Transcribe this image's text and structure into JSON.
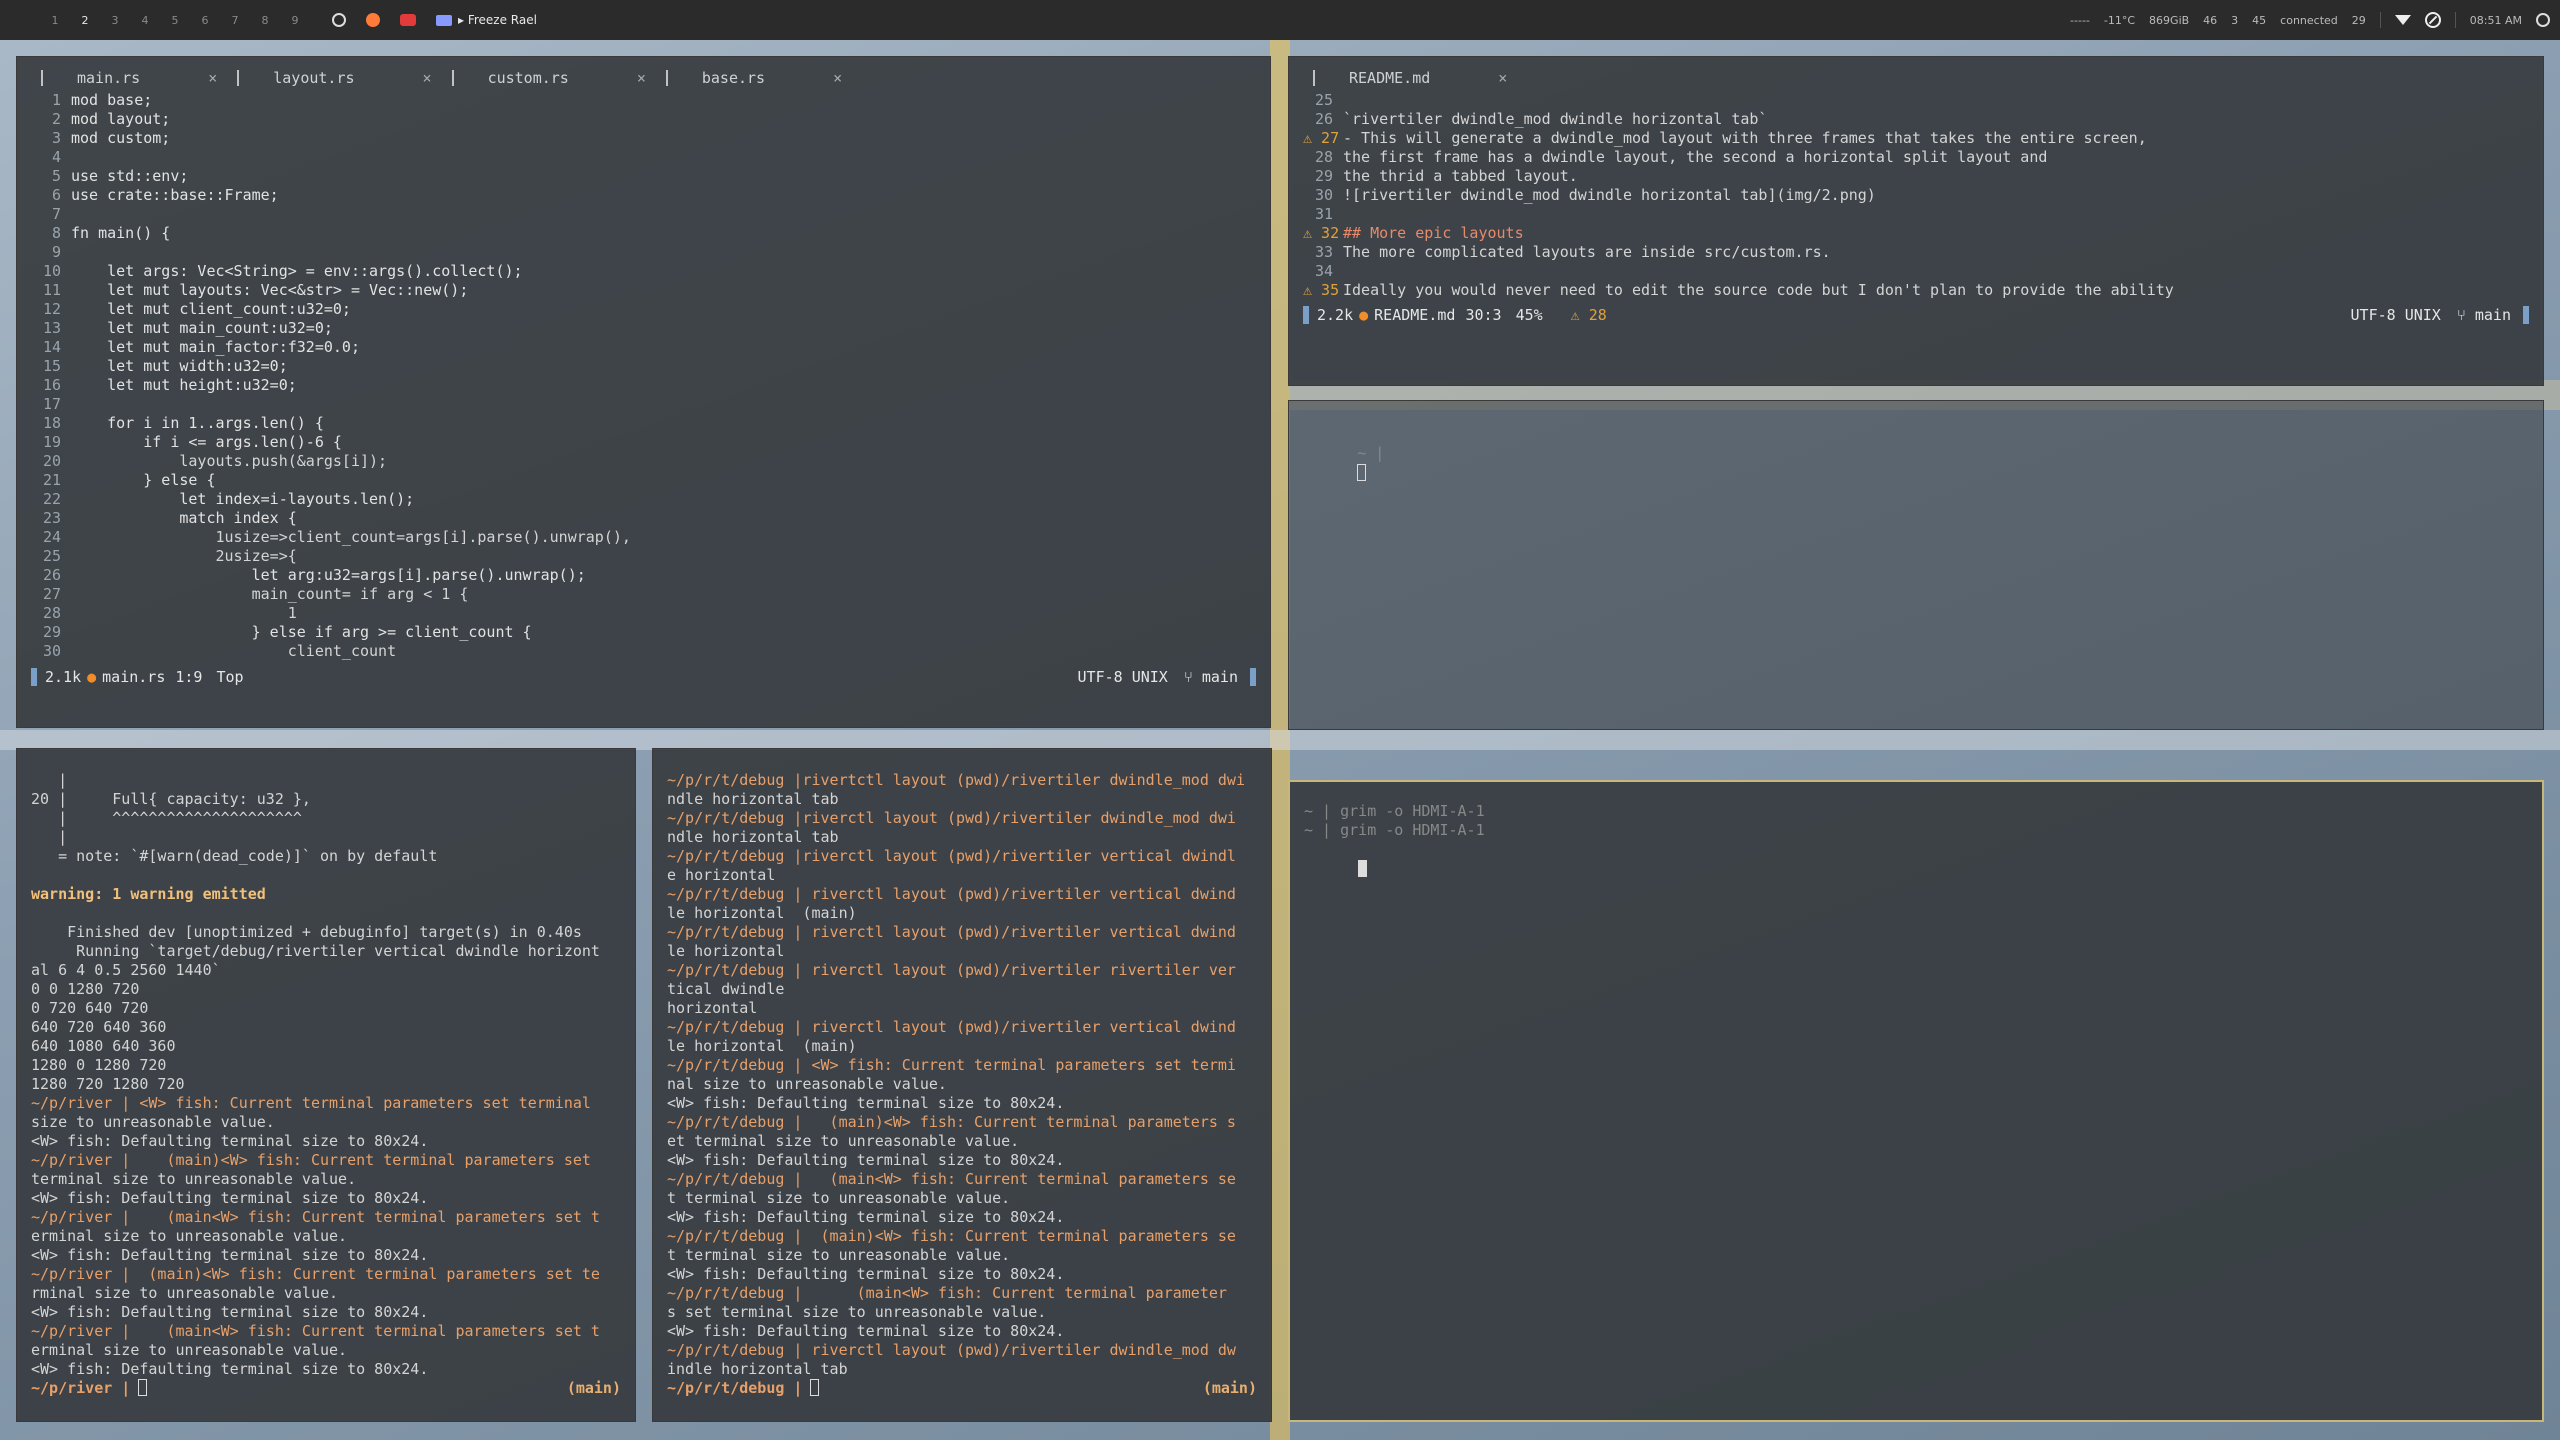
{
  "topbar": {
    "tags": [
      "1",
      "2",
      "3",
      "4",
      "5",
      "6",
      "7",
      "8",
      "9"
    ],
    "active_tag": "2",
    "freeze_label": "▸ Freeze Rael",
    "status": {
      "audio": "-----",
      "temp": "-11°C",
      "disk": "869GiB",
      "cpu": "46",
      "mem": "3",
      "net": "45",
      "vpn": "connected",
      "battery": "29",
      "clock": "08:51 AM"
    },
    "icons": [
      "github-icon",
      "reddit-icon",
      "youtube-icon",
      "mail-icon",
      "wifi-icon",
      "dnd-icon",
      "power-icon"
    ]
  },
  "editor_main": {
    "tabs": [
      {
        "name": "main.rs",
        "close": "×"
      },
      {
        "name": "layout.rs",
        "close": "×"
      },
      {
        "name": "custom.rs",
        "close": "×"
      },
      {
        "name": "base.rs",
        "close": "×"
      }
    ],
    "lines": [
      [
        "1",
        "mod base;"
      ],
      [
        "2",
        "mod layout;"
      ],
      [
        "3",
        "mod custom;"
      ],
      [
        "4",
        ""
      ],
      [
        "5",
        "use std::env;"
      ],
      [
        "6",
        "use crate::base::Frame;"
      ],
      [
        "7",
        ""
      ],
      [
        "8",
        "fn main() {"
      ],
      [
        "9",
        ""
      ],
      [
        "10",
        "    let args: Vec<String> = env::args().collect();"
      ],
      [
        "11",
        "    let mut layouts: Vec<&str> = Vec::new();"
      ],
      [
        "12",
        "    let mut client_count:u32=0;"
      ],
      [
        "13",
        "    let mut main_count:u32=0;"
      ],
      [
        "14",
        "    let mut main_factor:f32=0.0;"
      ],
      [
        "15",
        "    let mut width:u32=0;"
      ],
      [
        "16",
        "    let mut height:u32=0;"
      ],
      [
        "17",
        ""
      ],
      [
        "18",
        "    for i in 1..args.len() {"
      ],
      [
        "19",
        "        if i <= args.len()-6 {"
      ],
      [
        "20",
        "            layouts.push(&args[i]);"
      ],
      [
        "21",
        "        } else {"
      ],
      [
        "22",
        "            let index=i-layouts.len();"
      ],
      [
        "23",
        "            match index {"
      ],
      [
        "24",
        "                1usize=>client_count=args[i].parse().unwrap(),"
      ],
      [
        "25",
        "                2usize=>{"
      ],
      [
        "26",
        "                    let arg:u32=args[i].parse().unwrap();"
      ],
      [
        "27",
        "                    main_count= if arg < 1 {"
      ],
      [
        "28",
        "                        1"
      ],
      [
        "29",
        "                    } else if arg >= client_count {"
      ],
      [
        "30",
        "                        client_count"
      ]
    ],
    "status": {
      "size": "2.1k",
      "file": "main.rs",
      "pos": "1:9",
      "scroll": "Top",
      "encoding": "UTF-8 UNIX",
      "branch": "⑂ main"
    }
  },
  "editor_readme": {
    "tabs": [
      {
        "name": "README.md",
        "close": "×"
      }
    ],
    "lines": [
      [
        "25",
        "",
        false
      ],
      [
        "26",
        "`rivertiler dwindle_mod dwindle horizontal tab`",
        false
      ],
      [
        "27",
        "- This will generate a dwindle_mod layout with three frames that takes the entire screen,",
        true
      ],
      [
        "28",
        "the first frame has a dwindle layout, the second a horizontal split layout and",
        false
      ],
      [
        "29",
        "the thrid a tabbed layout.",
        false
      ],
      [
        "30",
        "![rivertiler dwindle_mod dwindle horizontal tab](img/2.png)",
        false
      ],
      [
        "31",
        "",
        false
      ],
      [
        "32",
        "## More epic layouts",
        true
      ],
      [
        "33",
        "The more complicated layouts are inside src/custom.rs.",
        false
      ],
      [
        "34",
        "",
        false
      ],
      [
        "35",
        "Ideally you would never need to edit the source code but I don't plan to provide the ability",
        true
      ]
    ],
    "status": {
      "size": "2.2k",
      "file": "README.md",
      "pos": "30:3",
      "scroll": "45%",
      "warnings": "⚠ 28",
      "encoding": "UTF-8 UNIX",
      "branch": "⑂ main"
    }
  },
  "term_empty": {
    "prompt": "~ |"
  },
  "term_grim": {
    "lines": [
      "~ | grim -o HDMI-A-1",
      "~ | grim -o HDMI-A-1"
    ]
  },
  "term_cargo": {
    "lines": [
      "   |",
      "20 |     Full{ capacity: u32 },",
      "   |     ^^^^^^^^^^^^^^^^^^^^^",
      "   |",
      "   = note: `#[warn(dead_code)]` on by default",
      "",
      "warning: 1 warning emitted",
      "",
      "    Finished dev [unoptimized + debuginfo] target(s) in 0.40s",
      "     Running `target/debug/rivertiler vertical dwindle horizont",
      "al 6 4 0.5 2560 1440`",
      "0 0 1280 720",
      "0 720 640 720",
      "640 720 640 360",
      "640 1080 640 360",
      "1280 0 1280 720",
      "1280 720 1280 720",
      "~/p/river | <W> fish: Current terminal parameters set terminal",
      "size to unreasonable value.",
      "<W> fish: Defaulting terminal size to 80x24.",
      "~/p/river |    (main)<W> fish: Current terminal parameters set",
      "terminal size to unreasonable value.",
      "<W> fish: Defaulting terminal size to 80x24.",
      "~/p/river |    (main<W> fish: Current terminal parameters set t",
      "erminal size to unreasonable value.",
      "<W> fish: Defaulting terminal size to 80x24.",
      "~/p/river |  (main)<W> fish: Current terminal parameters set te",
      "rminal size to unreasonable value.",
      "<W> fish: Defaulting terminal size to 80x24.",
      "~/p/river |    (main<W> fish: Current terminal parameters set t",
      "erminal size to unreasonable value.",
      "<W> fish: Defaulting terminal size to 80x24."
    ],
    "prompt": "~/p/river |",
    "git": "(main)"
  },
  "term_debug": {
    "lines": [
      "~/p/r/t/debug |rivertctl layout (pwd)/rivertiler dwindle_mod dwi",
      "ndle horizontal tab",
      "~/p/r/t/debug |riverctl layout (pwd)/rivertiler dwindle_mod dwi",
      "ndle horizontal tab",
      "~/p/r/t/debug |riverctl layout (pwd)/rivertiler vertical dwindl",
      "e horizontal",
      "~/p/r/t/debug | riverctl layout (pwd)/rivertiler vertical dwind",
      "le horizontal  (main)",
      "~/p/r/t/debug | riverctl layout (pwd)/rivertiler vertical dwind",
      "le horizontal",
      "~/p/r/t/debug | riverctl layout (pwd)/rivertiler rivertiler ver",
      "tical dwindle",
      "horizontal",
      "~/p/r/t/debug | riverctl layout (pwd)/rivertiler vertical dwind",
      "le horizontal  (main)",
      "~/p/r/t/debug | <W> fish: Current terminal parameters set termi",
      "nal size to unreasonable value.",
      "<W> fish: Defaulting terminal size to 80x24.",
      "~/p/r/t/debug |   (main)<W> fish: Current terminal parameters s",
      "et terminal size to unreasonable value.",
      "<W> fish: Defaulting terminal size to 80x24.",
      "~/p/r/t/debug |   (main<W> fish: Current terminal parameters se",
      "t terminal size to unreasonable value.",
      "<W> fish: Defaulting terminal size to 80x24.",
      "~/p/r/t/debug |  (main)<W> fish: Current terminal parameters se",
      "t terminal size to unreasonable value.",
      "<W> fish: Defaulting terminal size to 80x24.",
      "~/p/r/t/debug |      (main<W> fish: Current terminal parameter",
      "s set terminal size to unreasonable value.",
      "<W> fish: Defaulting terminal size to 80x24.",
      "~/p/r/t/debug | riverctl layout (pwd)/rivertiler dwindle_mod dw",
      "indle horizontal tab"
    ],
    "prompt": "~/p/r/t/debug |",
    "git": "(main)"
  }
}
